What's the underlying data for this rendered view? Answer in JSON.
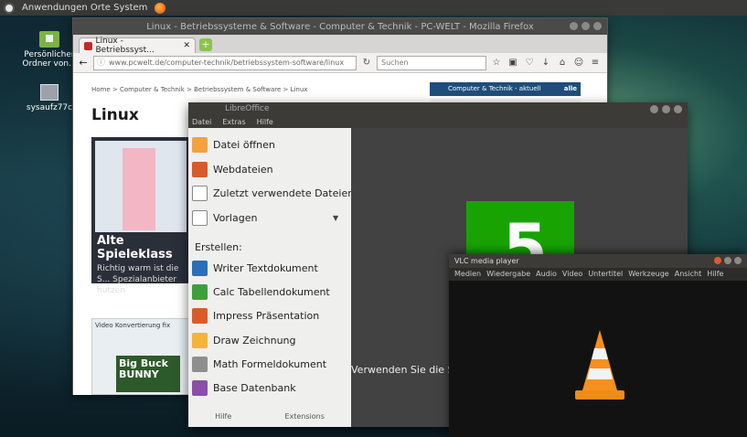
{
  "panel": {
    "menu_label": "Anwendungen  Orte  System"
  },
  "desktop": {
    "home_label": "Persönlicher Ordner von...",
    "drive_label": "sysaufz77c"
  },
  "firefox": {
    "title": "Linux - Betriebssysteme & Software - Computer & Technik - PC-WELT - Mozilla Firefox",
    "tab_label": "Linux - Betriebssyst...",
    "url": "www.pcwelt.de/computer-technik/betriebssystem-software/linux",
    "search_placeholder": "Suchen",
    "breadcrumb": "Home > Computer & Technik > Betriebssystem & Software > Linux",
    "page_title": "Linux",
    "side_title": "Computer & Technik - aktuell",
    "side_more": "alle",
    "teaser_title": "Alte Spieleklass",
    "teaser_text": "Richtig warm ist die S... Spezialanbieter hutzen",
    "teaser2_title": "Big Buck BUNNY",
    "teaser2_header": "Video Konvertierung fix"
  },
  "libreoffice": {
    "title": "LibreOffice",
    "menu": [
      "Datei",
      "Extras",
      "Hilfe"
    ],
    "items": {
      "open": "Datei öffnen",
      "remote": "Webdateien",
      "recent": "Zuletzt verwendete Dateien",
      "templates": "Vorlagen",
      "create": "Erstellen:",
      "writer": "Writer Textdokument",
      "calc": "Calc Tabellendokument",
      "impress": "Impress Präsentation",
      "draw": "Draw Zeichnung",
      "math": "Math Formeldokument",
      "base": "Base Datenbank"
    },
    "footer": [
      "Hilfe",
      "Extensions"
    ],
    "logo_number": "5",
    "hint": "Verwenden Sie die Seit"
  },
  "vlc": {
    "title": "VLC media player",
    "menu": [
      "Medien",
      "Wiedergabe",
      "Audio",
      "Video",
      "Untertitel",
      "Werkzeuge",
      "Ansicht",
      "Hilfe"
    ]
  }
}
